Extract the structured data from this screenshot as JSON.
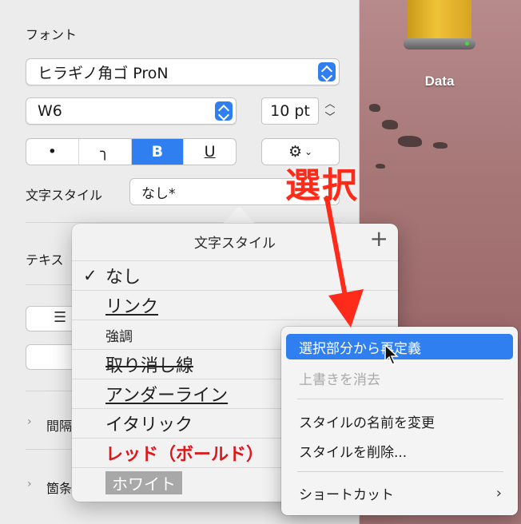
{
  "desktop": {
    "drive_label": "Data"
  },
  "panel": {
    "font_section_title": "フォント",
    "font_family": "ヒラギノ角ゴ ProN",
    "font_weight": "W6",
    "font_size": "10 pt",
    "format_buttons": [
      "•",
      "╮",
      "B",
      "U"
    ],
    "char_style_label": "文字スタイル",
    "char_style_value": "なし*",
    "text_label": "テキス",
    "spacing_label": "間隔",
    "bullets_label": "箇条"
  },
  "popover": {
    "title": "文字スタイル",
    "add_label": "+",
    "check_mark": "✓",
    "items": [
      "なし",
      "リンク",
      "強調",
      "取り消し線",
      "アンダーライン",
      "イタリック",
      "レッド（ボールド）",
      "ホワイト"
    ]
  },
  "context_menu": {
    "items": [
      "選択部分から再定義",
      "上書きを消去",
      "スタイルの名前を変更",
      "スタイルを削除...",
      "ショートカット"
    ]
  },
  "annotation": {
    "text": "選択",
    "color": "#ff2b1a"
  },
  "colors": {
    "accent": "#2f7ff0"
  }
}
